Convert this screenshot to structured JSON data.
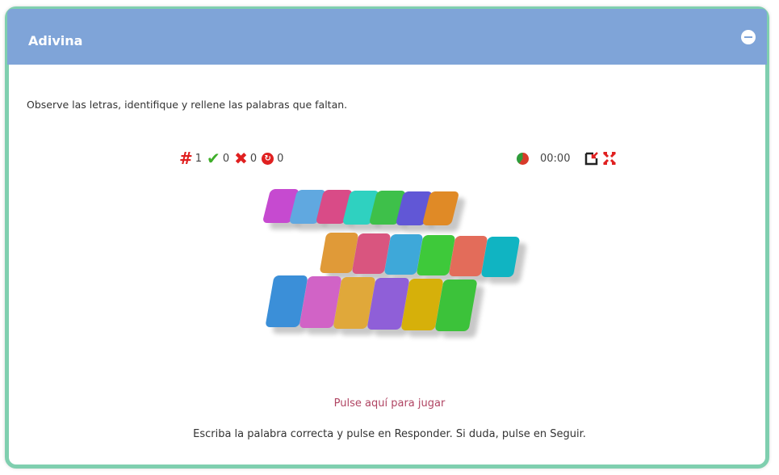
{
  "panel": {
    "title": "Adivina",
    "collapse_icon": "minus-circle-icon"
  },
  "instructions": "Observe las letras, identifique y rellene las palabras que faltan.",
  "stats": {
    "word_number": "1",
    "correct": "0",
    "incorrect": "0",
    "lives": "0",
    "icons": {
      "word": "hash-icon",
      "correct": "checkmark-icon",
      "incorrect": "cross-icon",
      "lives": "life-icon"
    }
  },
  "timer": {
    "value": "00:00",
    "icons": [
      "clock-icon",
      "exit-fullscreen-icon",
      "fullscreen-icon"
    ]
  },
  "cards": {
    "rows": [
      [
        "#c64ad0",
        "#60a8e0",
        "#d94b87",
        "#2fd1c0",
        "#3ec04a",
        "#6157d6",
        "#e08a26"
      ],
      [
        "#e09a38",
        "#d9557f",
        "#3ea8d9",
        "#3ec93a",
        "#e36c5a",
        "#10b4c2"
      ],
      [
        "#3b8fd8",
        "#d163c6",
        "#e0a83a",
        "#8f5fd8",
        "#d6b00a",
        "#3cc23a"
      ]
    ]
  },
  "play_link": "Pulse aquí para jugar",
  "footer_text": "Escriba la palabra correcta y pulse en Responder. Si duda, pulse en Seguir."
}
